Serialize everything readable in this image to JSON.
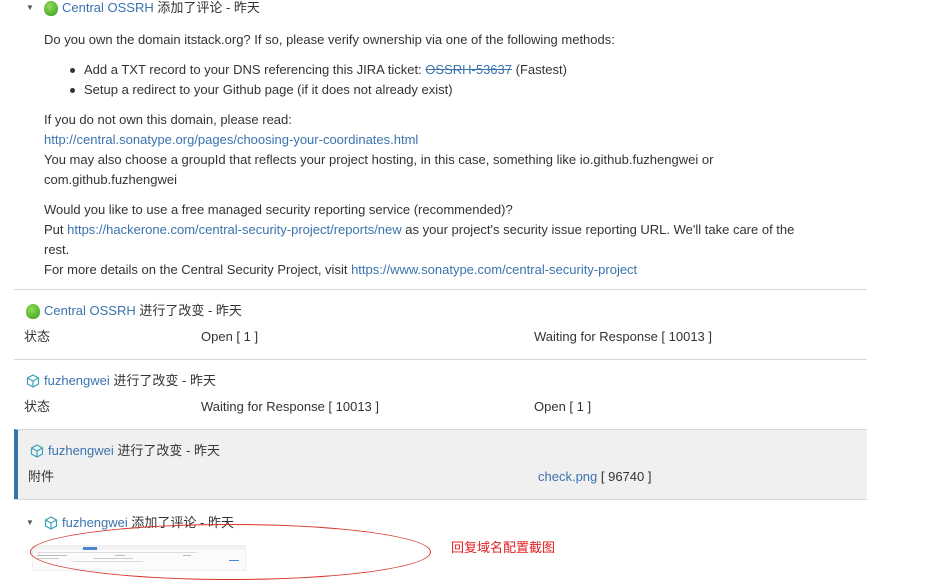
{
  "comment1": {
    "author": "Central OSSRH",
    "action": "添加了评论 - 昨天",
    "line1": "Do you own the domain itstack.org? If so, please verify ownership via one of the following methods:",
    "bullet1_prefix": "Add a TXT record to your DNS referencing this JIRA ticket: ",
    "bullet1_ticket": "OSSRH-53637",
    "bullet1_suffix": " (Fastest)",
    "bullet2": "Setup a redirect to your Github page (if it does not already exist)",
    "read_label": "If you do not own this domain, please read:",
    "read_link": "http://central.sonatype.org/pages/choosing-your-coordinates.html",
    "groupid_line1": "You may also choose a groupId that reflects your project hosting, in this case, something like io.github.fuzhengwei or",
    "groupid_line2": "com.github.fuzhengwei",
    "security_q": "Would you like to use a free managed security reporting service (recommended)?",
    "put_prefix": "Put ",
    "put_link": "https://hackerone.com/central-security-project/reports/new",
    "put_suffix_1": " as your project's security issue reporting URL. We'll take care of the",
    "put_suffix_2": "rest.",
    "details_prefix": "For more details on the Central Security Project, visit ",
    "details_link": "https://www.sonatype.com/central-security-project"
  },
  "changes": [
    {
      "author": "Central OSSRH",
      "action": "进行了改变 - 昨天",
      "field": "状态",
      "from": "Open [ 1 ]",
      "to": "Waiting for Response [ 10013 ]",
      "to_link": "",
      "to_rest": ""
    },
    {
      "author": "fuzhengwei",
      "action": "进行了改变 - 昨天",
      "field": "状态",
      "from": "Waiting for Response [ 10013 ]",
      "to": "Open [ 1 ]",
      "to_link": "",
      "to_rest": ""
    },
    {
      "author": "fuzhengwei",
      "action": "进行了改变 - 昨天",
      "field": "附件",
      "from": "",
      "to": "",
      "to_link": "check.png",
      "to_rest": " [ 96740 ]"
    }
  ],
  "comment2": {
    "author": "fuzhengwei",
    "action": "添加了评论 - 昨天"
  },
  "annotation": "回复域名配置截图",
  "colors": {
    "link": "#3b73af",
    "annotation": "#e02020",
    "highlight_bar": "#3572b0"
  }
}
